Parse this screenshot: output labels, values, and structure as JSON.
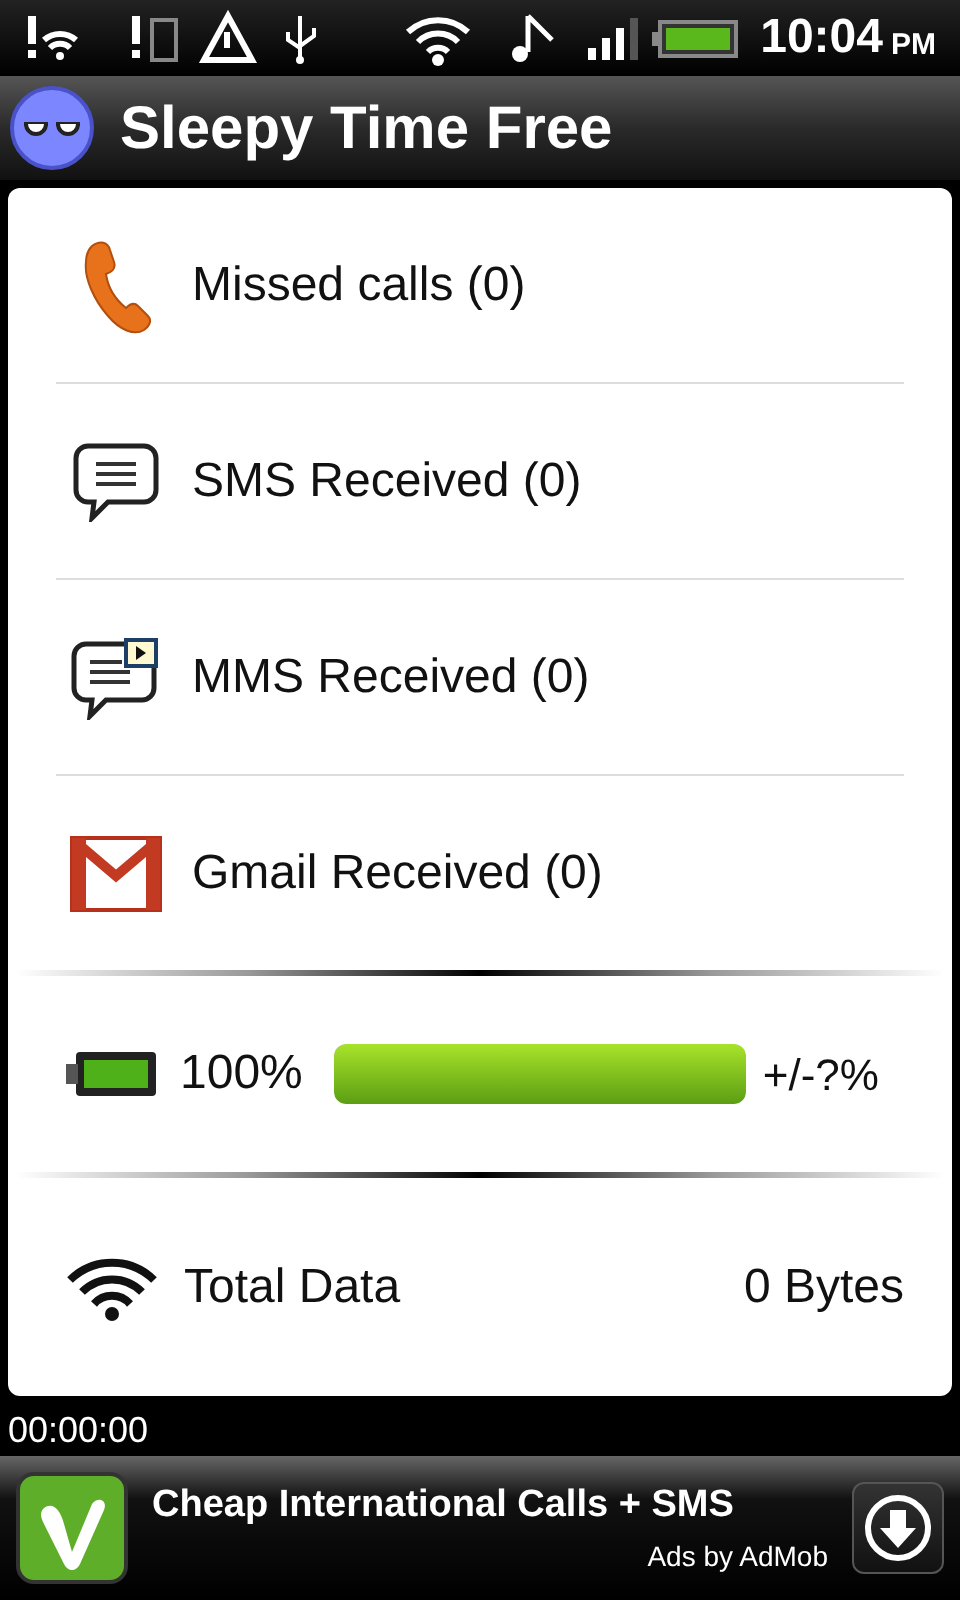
{
  "status_bar": {
    "time": "10:04",
    "meridiem": "PM"
  },
  "app_bar": {
    "title": "Sleepy Time Free"
  },
  "notifications": [
    {
      "kind": "call",
      "label": "Missed calls (0)"
    },
    {
      "kind": "sms",
      "label": "SMS Received (0)"
    },
    {
      "kind": "mms",
      "label": "MMS Received (0)"
    },
    {
      "kind": "gmail",
      "label": "Gmail Received (0)"
    }
  ],
  "battery": {
    "reading": "100%",
    "level": 1,
    "accuracy": "+/-?%"
  },
  "data": {
    "label": "Total Data",
    "value": "0 Bytes"
  },
  "timer": "00:00:00",
  "ad": {
    "headline": "Cheap International Calls + SMS",
    "credit": "Ads by AdMob"
  }
}
